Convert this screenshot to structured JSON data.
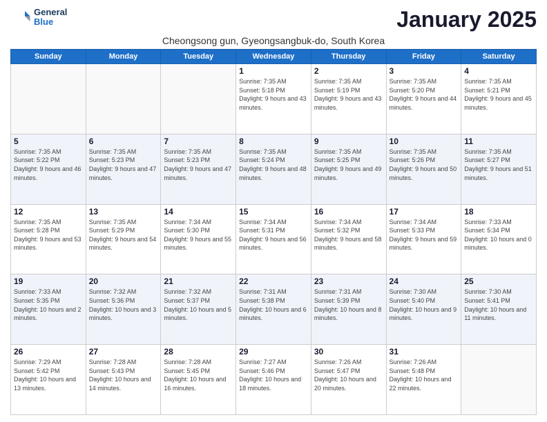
{
  "header": {
    "logo_line1": "General",
    "logo_line2": "Blue",
    "title": "January 2025",
    "location": "Cheongsong gun, Gyeongsangbuk-do, South Korea"
  },
  "weekdays": [
    "Sunday",
    "Monday",
    "Tuesday",
    "Wednesday",
    "Thursday",
    "Friday",
    "Saturday"
  ],
  "weeks": [
    [
      {
        "day": "",
        "info": ""
      },
      {
        "day": "",
        "info": ""
      },
      {
        "day": "",
        "info": ""
      },
      {
        "day": "1",
        "info": "Sunrise: 7:35 AM\nSunset: 5:18 PM\nDaylight: 9 hours and 43 minutes."
      },
      {
        "day": "2",
        "info": "Sunrise: 7:35 AM\nSunset: 5:19 PM\nDaylight: 9 hours and 43 minutes."
      },
      {
        "day": "3",
        "info": "Sunrise: 7:35 AM\nSunset: 5:20 PM\nDaylight: 9 hours and 44 minutes."
      },
      {
        "day": "4",
        "info": "Sunrise: 7:35 AM\nSunset: 5:21 PM\nDaylight: 9 hours and 45 minutes."
      }
    ],
    [
      {
        "day": "5",
        "info": "Sunrise: 7:35 AM\nSunset: 5:22 PM\nDaylight: 9 hours and 46 minutes."
      },
      {
        "day": "6",
        "info": "Sunrise: 7:35 AM\nSunset: 5:23 PM\nDaylight: 9 hours and 47 minutes."
      },
      {
        "day": "7",
        "info": "Sunrise: 7:35 AM\nSunset: 5:23 PM\nDaylight: 9 hours and 47 minutes."
      },
      {
        "day": "8",
        "info": "Sunrise: 7:35 AM\nSunset: 5:24 PM\nDaylight: 9 hours and 48 minutes."
      },
      {
        "day": "9",
        "info": "Sunrise: 7:35 AM\nSunset: 5:25 PM\nDaylight: 9 hours and 49 minutes."
      },
      {
        "day": "10",
        "info": "Sunrise: 7:35 AM\nSunset: 5:26 PM\nDaylight: 9 hours and 50 minutes."
      },
      {
        "day": "11",
        "info": "Sunrise: 7:35 AM\nSunset: 5:27 PM\nDaylight: 9 hours and 51 minutes."
      }
    ],
    [
      {
        "day": "12",
        "info": "Sunrise: 7:35 AM\nSunset: 5:28 PM\nDaylight: 9 hours and 53 minutes."
      },
      {
        "day": "13",
        "info": "Sunrise: 7:35 AM\nSunset: 5:29 PM\nDaylight: 9 hours and 54 minutes."
      },
      {
        "day": "14",
        "info": "Sunrise: 7:34 AM\nSunset: 5:30 PM\nDaylight: 9 hours and 55 minutes."
      },
      {
        "day": "15",
        "info": "Sunrise: 7:34 AM\nSunset: 5:31 PM\nDaylight: 9 hours and 56 minutes."
      },
      {
        "day": "16",
        "info": "Sunrise: 7:34 AM\nSunset: 5:32 PM\nDaylight: 9 hours and 58 minutes."
      },
      {
        "day": "17",
        "info": "Sunrise: 7:34 AM\nSunset: 5:33 PM\nDaylight: 9 hours and 59 minutes."
      },
      {
        "day": "18",
        "info": "Sunrise: 7:33 AM\nSunset: 5:34 PM\nDaylight: 10 hours and 0 minutes."
      }
    ],
    [
      {
        "day": "19",
        "info": "Sunrise: 7:33 AM\nSunset: 5:35 PM\nDaylight: 10 hours and 2 minutes."
      },
      {
        "day": "20",
        "info": "Sunrise: 7:32 AM\nSunset: 5:36 PM\nDaylight: 10 hours and 3 minutes."
      },
      {
        "day": "21",
        "info": "Sunrise: 7:32 AM\nSunset: 5:37 PM\nDaylight: 10 hours and 5 minutes."
      },
      {
        "day": "22",
        "info": "Sunrise: 7:31 AM\nSunset: 5:38 PM\nDaylight: 10 hours and 6 minutes."
      },
      {
        "day": "23",
        "info": "Sunrise: 7:31 AM\nSunset: 5:39 PM\nDaylight: 10 hours and 8 minutes."
      },
      {
        "day": "24",
        "info": "Sunrise: 7:30 AM\nSunset: 5:40 PM\nDaylight: 10 hours and 9 minutes."
      },
      {
        "day": "25",
        "info": "Sunrise: 7:30 AM\nSunset: 5:41 PM\nDaylight: 10 hours and 11 minutes."
      }
    ],
    [
      {
        "day": "26",
        "info": "Sunrise: 7:29 AM\nSunset: 5:42 PM\nDaylight: 10 hours and 13 minutes."
      },
      {
        "day": "27",
        "info": "Sunrise: 7:28 AM\nSunset: 5:43 PM\nDaylight: 10 hours and 14 minutes."
      },
      {
        "day": "28",
        "info": "Sunrise: 7:28 AM\nSunset: 5:45 PM\nDaylight: 10 hours and 16 minutes."
      },
      {
        "day": "29",
        "info": "Sunrise: 7:27 AM\nSunset: 5:46 PM\nDaylight: 10 hours and 18 minutes."
      },
      {
        "day": "30",
        "info": "Sunrise: 7:26 AM\nSunset: 5:47 PM\nDaylight: 10 hours and 20 minutes."
      },
      {
        "day": "31",
        "info": "Sunrise: 7:26 AM\nSunset: 5:48 PM\nDaylight: 10 hours and 22 minutes."
      },
      {
        "day": "",
        "info": ""
      }
    ]
  ]
}
